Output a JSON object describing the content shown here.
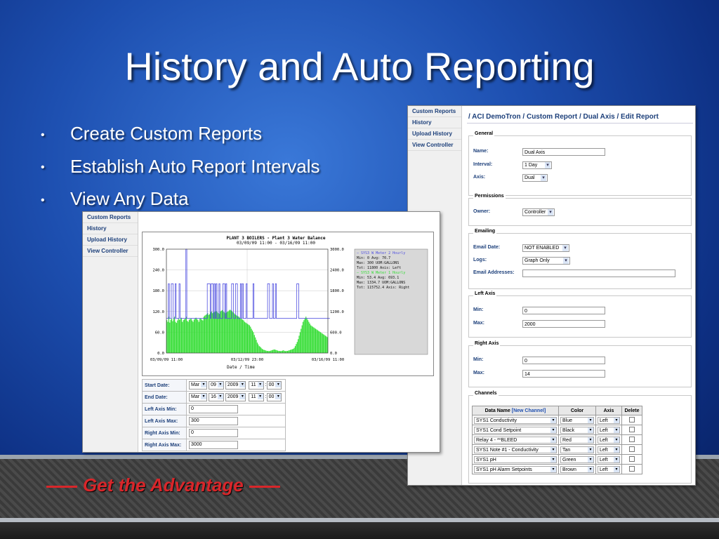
{
  "slide": {
    "title": "History and Auto Reporting",
    "bullets": [
      "Create Custom Reports",
      "Establish Auto Report Intervals",
      "View Any Data"
    ],
    "tagline": "Get the Advantage"
  },
  "colors": {
    "accent_red": "#d8262a",
    "series_blue": "#5050e0",
    "series_green": "#33dd33",
    "link_blue": "#1c3f7a"
  },
  "right_screen": {
    "nav": [
      "Custom Reports",
      "History",
      "Upload History",
      "View Controller"
    ],
    "breadcrumb": "/ ACI DemoTron / Custom Report / Dual Axis / Edit Report",
    "general": {
      "legend": "General",
      "name_label": "Name:",
      "name_value": "Dual Axis",
      "interval_label": "Interval:",
      "interval_value": "1 Day",
      "axis_label": "Axis:",
      "axis_value": "Dual"
    },
    "permissions": {
      "legend": "Permissions",
      "owner_label": "Owner:",
      "owner_value": "Controller"
    },
    "emailing": {
      "legend": "Emailing",
      "date_label": "Email Date:",
      "date_value": "NOT ENABLED",
      "logs_label": "Logs:",
      "logs_value": "Graph Only",
      "addresses_label": "Email Addresses:",
      "addresses_value": ""
    },
    "left_axis": {
      "legend": "Left Axis",
      "min_label": "Min:",
      "min_value": "0",
      "max_label": "Max:",
      "max_value": "2000"
    },
    "right_axis": {
      "legend": "Right Axis",
      "min_label": "Min:",
      "min_value": "0",
      "max_label": "Max:",
      "max_value": "14"
    },
    "channels": {
      "legend": "Channels",
      "headers": {
        "data_name": "Data Name",
        "new_channel": "[New Channel]",
        "color": "Color",
        "axis": "Axis",
        "delete": "Delete"
      },
      "rows": [
        {
          "name": "SYS1 Conductivity",
          "color": "Blue",
          "axis": "Left"
        },
        {
          "name": "SYS1 Cond Setpoint",
          "color": "Black",
          "axis": "Left"
        },
        {
          "name": "Relay 4 - **BLEED",
          "color": "Red",
          "axis": "Left"
        },
        {
          "name": "SYS1 Note #1 - Conductivity",
          "color": "Tan",
          "axis": "Left"
        },
        {
          "name": "SYS1 pH",
          "color": "Green",
          "axis": "Left"
        },
        {
          "name": "SYS1 pH Alarm Setpoints",
          "color": "Brown",
          "axis": "Left"
        }
      ]
    }
  },
  "left_screen": {
    "nav": [
      "Custom Reports",
      "History",
      "Upload History",
      "View Controller"
    ],
    "chart_title": "PLANT 3 BOILERS -      Plant 3 Water Balance",
    "chart_subtitle": "03/09/09 11:00 - 03/16/09 11:00",
    "x_tick_labels": [
      "03/09/09 11:00",
      "03/12/09 23:00",
      "03/16/09 11:00"
    ],
    "x_axis_label": "Date / Time",
    "legend_lines": [
      "— SYS3 W Meter 2 Hourly",
      "  Min: 0         Avg: 70.7",
      "  Max: 300       UOM:GALLONS",
      "  Tot: 11800     Axis: Left",
      "— SYS3 W Meter 1 Hourly",
      "  Min: 53.4      Avg: 693.1",
      "  Max: 1334.7    UOM:GALLONS",
      "  Tot: 115752.4  Axis: Right"
    ],
    "form": {
      "start_label": "Start Date:",
      "start": [
        "Mar",
        "09",
        "2009",
        "11",
        "00"
      ],
      "end_label": "End Date:",
      "end": [
        "Mar",
        "16",
        "2009",
        "11",
        "00"
      ],
      "left_min_label": "Left Axis Min:",
      "left_min": "0",
      "left_max_label": "Left Axis Max:",
      "left_max": "300",
      "right_min_label": "Right Axis Min:",
      "right_min": "0",
      "right_max_label": "Right Axis Max:",
      "right_max": "3000"
    }
  },
  "chart_data": {
    "type": "bar",
    "title": "PLANT 3 BOILERS -      Plant 3 Water Balance",
    "subtitle": "03/09/09 11:00 - 03/16/09 11:00",
    "xlabel": "Date / Time",
    "x_ticks": [
      "03/09/09 11:00",
      "03/12/09 23:00",
      "03/16/09 11:00"
    ],
    "y_left": {
      "ticks": [
        "0.0",
        "60.0",
        "120.0",
        "180.0",
        "240.0",
        "300.0"
      ],
      "ylim": [
        0,
        300
      ]
    },
    "y_right": {
      "ticks": [
        "0.0",
        "600.0",
        "1200.0",
        "1800.0",
        "2400.0",
        "3000.0"
      ],
      "ylim": [
        0,
        3000
      ]
    },
    "grid": true,
    "legend_position": "right",
    "series": [
      {
        "name": "SYS3 W Meter 2 Hourly",
        "axis": "left",
        "color": "#5050e0",
        "values": [
          100,
          100,
          200,
          100,
          100,
          200,
          200,
          100,
          100,
          200,
          100,
          100,
          100,
          200,
          100,
          100,
          100,
          100,
          100,
          100,
          300,
          100,
          100,
          100,
          100,
          100,
          100,
          100,
          100,
          100,
          100,
          100,
          100,
          100,
          100,
          100,
          100,
          100,
          100,
          100,
          100,
          100,
          200,
          200,
          200,
          100,
          200,
          200,
          100,
          200,
          100,
          200,
          100,
          100,
          200,
          100,
          100,
          100,
          200,
          200,
          100,
          200,
          100,
          100,
          100,
          100,
          100,
          200,
          200,
          100,
          100,
          200,
          200,
          100,
          100,
          100,
          200,
          100,
          200,
          100,
          100,
          100,
          200,
          100,
          100,
          100,
          100,
          100,
          100,
          200,
          100,
          100,
          100,
          100,
          100,
          100,
          100,
          100,
          100,
          100,
          100,
          100,
          100,
          100,
          200,
          200,
          100,
          100,
          100,
          200,
          100,
          100,
          200,
          100,
          100,
          100,
          100,
          100,
          100,
          100,
          100,
          100,
          100,
          100,
          100,
          100,
          100,
          100,
          100,
          100,
          100,
          100,
          100,
          100,
          200,
          200,
          100,
          100,
          100,
          100,
          100,
          100,
          100,
          100,
          100,
          100,
          100,
          100,
          100,
          100,
          100,
          100,
          100,
          100,
          100,
          100,
          100,
          100,
          100,
          100,
          100,
          100,
          100,
          100,
          100,
          100,
          100,
          100
        ]
      },
      {
        "name": "SYS3 W Meter 1 Hourly",
        "axis": "right",
        "color": "#33dd33",
        "values": [
          950,
          900,
          1050,
          880,
          960,
          1000,
          920,
          980,
          1050,
          900,
          870,
          940,
          1000,
          960,
          980,
          1020,
          900,
          950,
          970,
          1000,
          1050,
          930,
          900,
          960,
          980,
          1000,
          940,
          900,
          960,
          1000,
          1020,
          980,
          950,
          900,
          990,
          1000,
          960,
          940,
          1050,
          1080,
          1100,
          1120,
          1150,
          1100,
          1120,
          1180,
          1200,
          1150,
          1170,
          1190,
          1200,
          1210,
          1180,
          1150,
          1130,
          1200,
          1220,
          1240,
          1200,
          1180,
          1150,
          1170,
          1190,
          1200,
          1230,
          1250,
          1230,
          1210,
          1180,
          1150,
          1120,
          1100,
          1080,
          1060,
          1050,
          1020,
          1000,
          980,
          960,
          940,
          900,
          880,
          860,
          840,
          820,
          800,
          760,
          700,
          650,
          600,
          520,
          450,
          380,
          300,
          250,
          200,
          180,
          150,
          120,
          100,
          90,
          80,
          70,
          60,
          60,
          55,
          60,
          70,
          80,
          90,
          100,
          100,
          90,
          80,
          70,
          60,
          60,
          55,
          60,
          70,
          80,
          60,
          55,
          60,
          60,
          70,
          80,
          90,
          100,
          110,
          120,
          150,
          200,
          260,
          320,
          400,
          500,
          600,
          700,
          800,
          900,
          950,
          1000,
          1050,
          1000,
          950,
          900,
          850,
          800,
          780,
          760,
          740,
          720,
          700,
          680,
          660,
          640,
          620,
          600,
          580,
          560,
          540,
          520,
          500,
          480,
          460
        ]
      }
    ]
  }
}
